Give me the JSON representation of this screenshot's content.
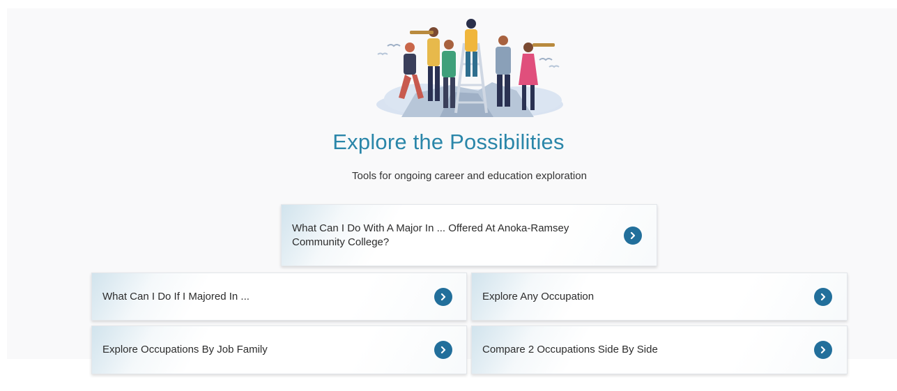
{
  "page": {
    "title": "Explore the Possibilities",
    "subtitle": "Tools for ongoing career and education exploration"
  },
  "cards": {
    "major_offered": "What Can I Do With A Major In ... Offered At Anoka-Ramsey Community College?",
    "majored_in": "What Can I Do If I Majored In ...",
    "any_occupation": "Explore Any Occupation",
    "job_family": "Explore Occupations By Job Family",
    "compare": "Compare 2 Occupations Side By Side"
  },
  "icons": {
    "card_arrow": "chevron-right-circle-icon",
    "hero": "explorers-illustration"
  },
  "colors": {
    "title": "#2a86a9",
    "accent": "#226f9b",
    "background": "#f9f9fa"
  }
}
